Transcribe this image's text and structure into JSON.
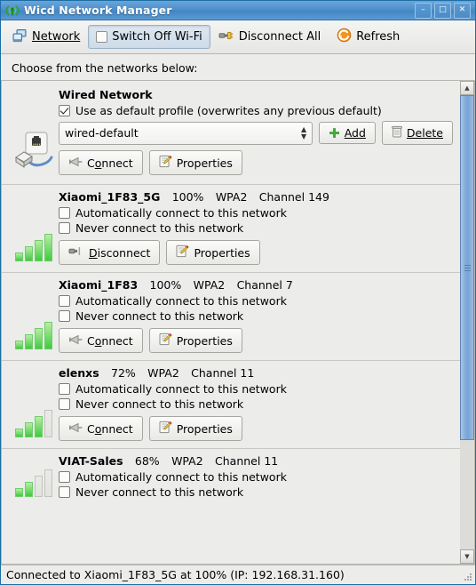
{
  "window": {
    "title": "Wicd Network Manager",
    "app_icon": "wifi-antenna-icon",
    "minimize_label": "–",
    "maximize_label": "□",
    "close_label": "✕"
  },
  "toolbar": {
    "network_label": "Network",
    "network_icon": "network-computers-icon",
    "switch_off_wifi_label": "Switch Off Wi-Fi",
    "disconnect_all_label": "Disconnect All",
    "disconnect_all_icon": "plug-unplug-icon",
    "refresh_label": "Refresh",
    "refresh_icon": "refresh-circle-icon",
    "overflow_arrow": "ⱟ",
    "wifi_toggled": true
  },
  "main": {
    "prompt": "Choose from the networks below:",
    "wired": {
      "name": "Wired Network",
      "icon": "ethernet-jack-icon",
      "default_profile_label": "Use as default profile (overwrites any previous default)",
      "default_profile_checked": true,
      "profile_value": "wired-default",
      "add_label": "Add",
      "add_icon": "plus-icon",
      "delete_label": "Delete",
      "delete_icon": "trash-icon",
      "connect_label": "Connect",
      "connect_icon": "antenna-icon",
      "properties_label": "Properties",
      "properties_icon": "notepad-pencil-icon"
    },
    "checkbox_labels": {
      "auto": "Automatically connect to this network",
      "never": "Never connect to this network"
    },
    "networks": [
      {
        "ssid": "Xiaomi_1F83_5G",
        "strength": "100%",
        "security": "WPA2",
        "channel": "Channel 149",
        "bars_on": 4,
        "bars_total": 4,
        "auto_connect": false,
        "never_connect": false,
        "action_label": "Disconnect",
        "action_icon": "plug-unplug-icon",
        "properties_label": "Properties",
        "properties_icon": "notepad-pencil-icon"
      },
      {
        "ssid": "Xiaomi_1F83",
        "strength": "100%",
        "security": "WPA2",
        "channel": "Channel 7",
        "bars_on": 4,
        "bars_total": 4,
        "auto_connect": false,
        "never_connect": false,
        "action_label": "Connect",
        "action_icon": "antenna-icon",
        "properties_label": "Properties",
        "properties_icon": "notepad-pencil-icon"
      },
      {
        "ssid": "elenxs",
        "strength": "72%",
        "security": "WPA2",
        "channel": "Channel 11",
        "bars_on": 3,
        "bars_total": 4,
        "auto_connect": false,
        "never_connect": false,
        "action_label": "Connect",
        "action_icon": "antenna-icon",
        "properties_label": "Properties",
        "properties_icon": "notepad-pencil-icon"
      },
      {
        "ssid": "VIAT-Sales",
        "strength": "68%",
        "security": "WPA2",
        "channel": "Channel 11",
        "bars_on": 2,
        "bars_total": 4,
        "auto_connect": false,
        "never_connect": false,
        "action_label": "Connect",
        "action_icon": "antenna-icon",
        "properties_label": "Properties",
        "properties_icon": "notepad-pencil-icon"
      }
    ]
  },
  "scrollbar": {
    "up_arrow": "▲",
    "down_arrow": "▼"
  },
  "statusbar": {
    "text": "Connected to Xiaomi_1F83_5G at 100% (IP: 192.168.31.160)"
  },
  "colors": {
    "titlebar": "#4f90cb",
    "signal_green": "#3ecb3e",
    "accent_blue": "#7fa9d8",
    "refresh_orange": "#f08a1c"
  }
}
